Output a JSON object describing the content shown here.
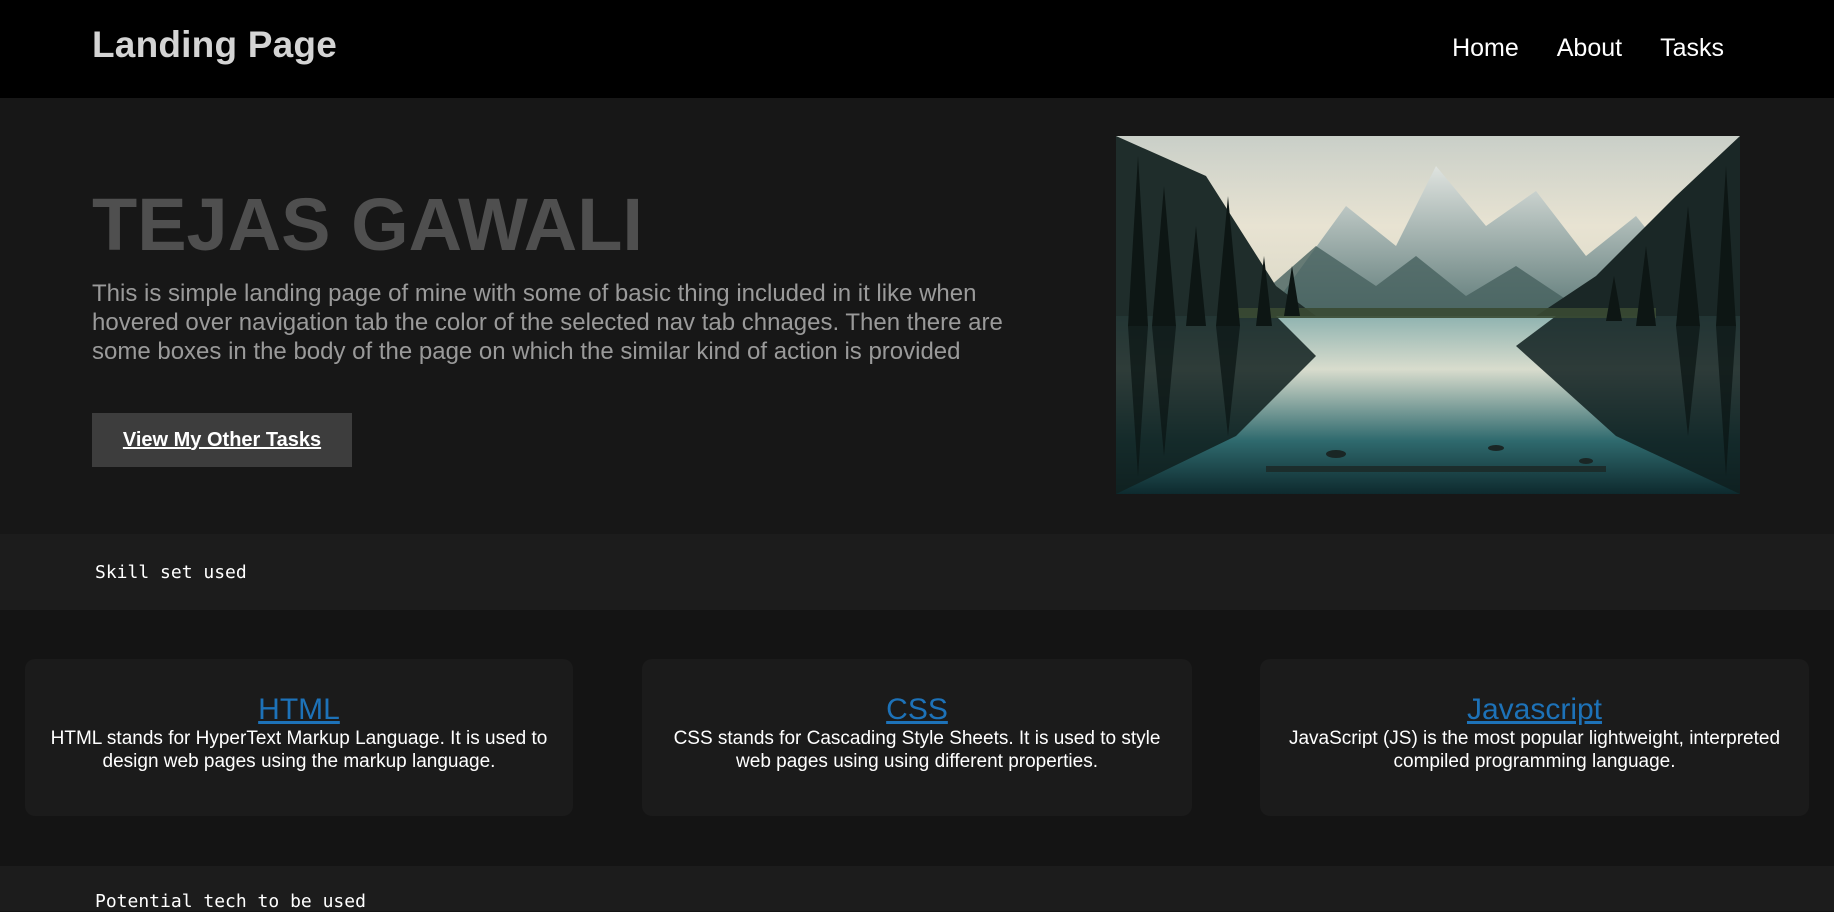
{
  "header": {
    "brand": "Landing Page",
    "nav": [
      "Home",
      "About",
      "Tasks"
    ]
  },
  "hero": {
    "title": "TEJAS GAWALI",
    "description": "This is simple landing page of mine with some of basic thing included in it like when hovered over navigation tab the color of the selected nav tab chnages. Then there are some boxes in the body of the page on which the similar kind of action is provided",
    "cta_label": "View My Other Tasks",
    "image_icon": "mountain-lake-landscape-image"
  },
  "sections": {
    "skills_label": "Skill set used",
    "potential_label": "Potential tech to be used"
  },
  "skills": [
    {
      "title": "HTML",
      "text": "HTML stands for HyperText Markup Language. It is used to design web pages using the markup language."
    },
    {
      "title": "CSS",
      "text": "CSS stands for Cascading Style Sheets. It is used to style web pages using using different properties."
    },
    {
      "title": "Javascript",
      "text": "JavaScript (JS) is the most popular lightweight, interpreted compiled programming language."
    }
  ],
  "colors": {
    "header_bg": "#000000",
    "hero_bg": "#171717",
    "title_color": "#4f4f4f",
    "link_color": "#1d72b8",
    "button_bg": "#3d3d3d"
  }
}
